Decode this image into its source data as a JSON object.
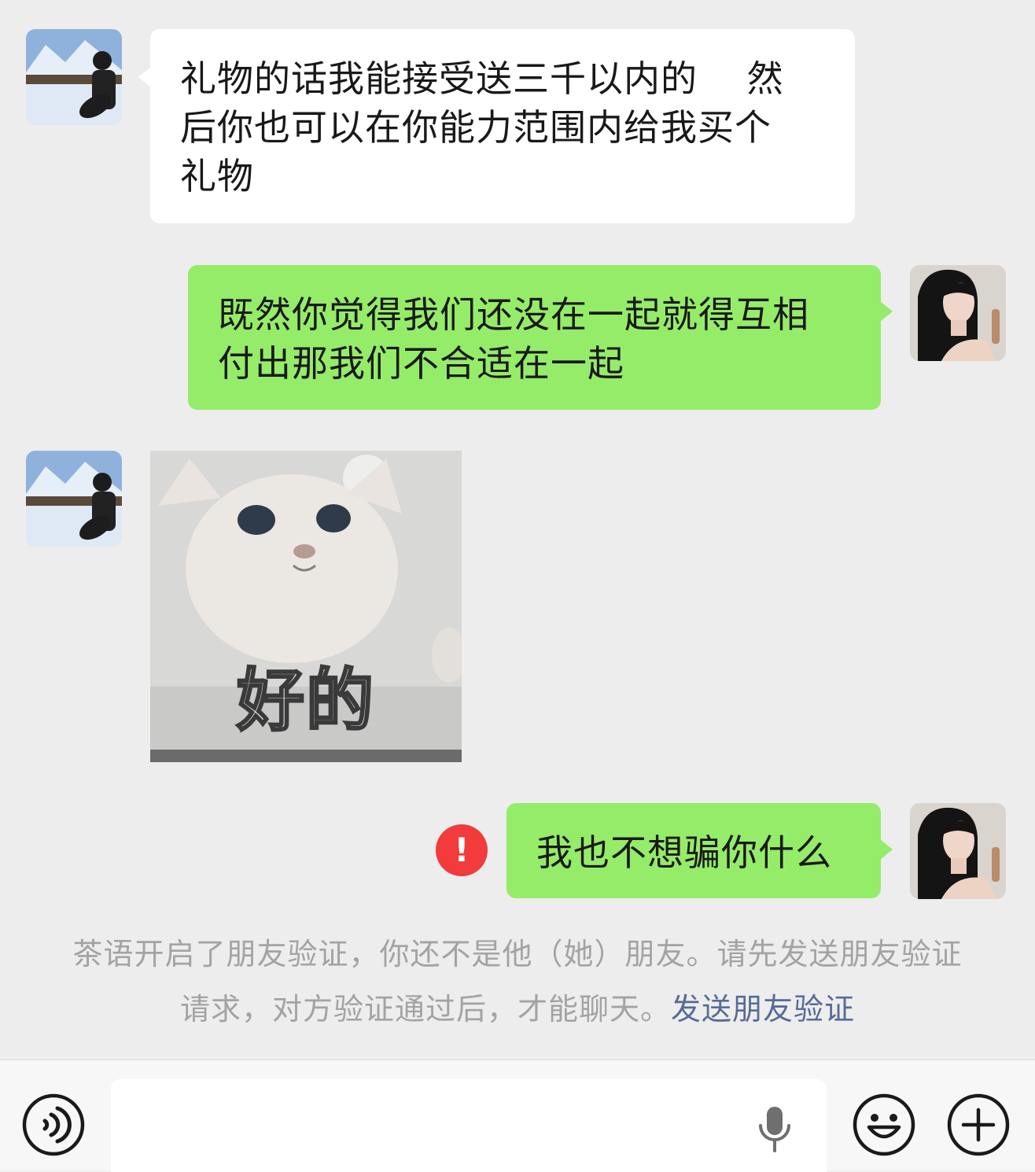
{
  "messages": [
    {
      "side": "incoming",
      "type": "text",
      "text": "礼物的话我能接受送三千以内的　 然\n后你也可以在你能力范围内给我买个\n礼物"
    },
    {
      "side": "outgoing",
      "type": "text",
      "text": "既然你觉得我们还没在一起就得互相\n付出那我们不合适在一起"
    },
    {
      "side": "incoming",
      "type": "sticker",
      "caption": "好的"
    },
    {
      "side": "outgoing",
      "type": "text",
      "text": "我也不想骗你什么",
      "status": "failed",
      "status_icon": "!"
    }
  ],
  "system_notice": {
    "text": "茶语开启了朋友验证，你还不是他（她）朋友。请先发送朋友验证请求，对方验证通过后，才能聊天。",
    "link": "发送朋友验证"
  },
  "input_bar": {
    "placeholder": "",
    "icons": [
      "voice-icon",
      "microphone-icon",
      "emoji-icon",
      "plus-icon"
    ]
  },
  "colors": {
    "background": "#ededed",
    "incoming_bubble": "#ffffff",
    "outgoing_bubble": "#95ec69",
    "error": "#f23b3b",
    "link": "#576b95"
  }
}
